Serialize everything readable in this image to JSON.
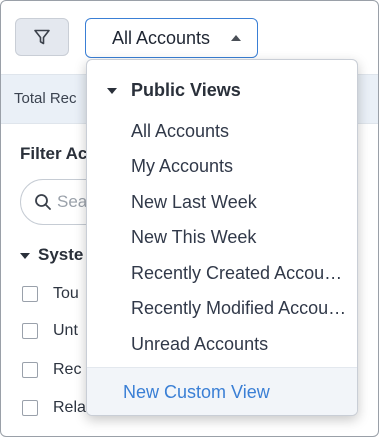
{
  "toolbar": {
    "filter_icon": "filter-funnel-icon",
    "view_selector": {
      "label": "All Accounts",
      "caret_icon": "caret-up-icon"
    }
  },
  "info_bar": {
    "text": "Total Rec"
  },
  "filter_panel": {
    "heading": "Filter Ac",
    "search": {
      "placeholder": "Sea",
      "icon": "search-icon"
    },
    "system_section": {
      "label": "Syste",
      "checkboxes": [
        {
          "label": "Tou",
          "checked": false
        },
        {
          "label": "Unt",
          "checked": false
        },
        {
          "label": "Rec",
          "checked": false
        },
        {
          "label": "Rela",
          "checked": false
        }
      ]
    }
  },
  "dropdown": {
    "section_label": "Public Views",
    "items": [
      "All Accounts",
      "My Accounts",
      "New Last Week",
      "New This Week",
      "Recently Created Accou…",
      "Recently Modified Accou…",
      "Unread Accounts"
    ],
    "footer_link": "New Custom View"
  },
  "colors": {
    "accent": "#3a7fd5",
    "info_bar_bg": "#eaf0f7",
    "filter_btn_bg": "#e4e8ef"
  }
}
